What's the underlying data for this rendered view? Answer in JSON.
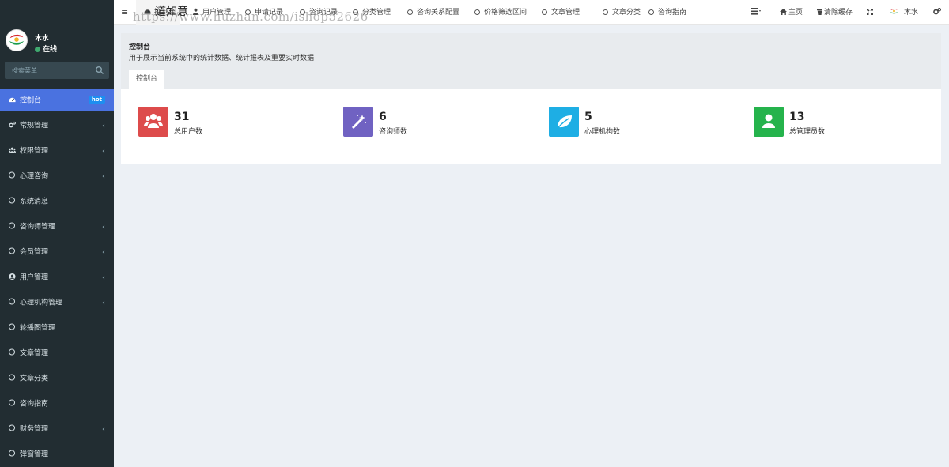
{
  "app": {
    "brand": "道如意",
    "watermark": "https://www.huzhan.com/ishop52626"
  },
  "user": {
    "name": "木水",
    "status": "在线"
  },
  "search": {
    "placeholder": "搜索菜单"
  },
  "sidebar": {
    "items": [
      {
        "label": "控制台",
        "icon": "dashboard-icon",
        "badge": "hot",
        "active": true
      },
      {
        "label": "常规管理",
        "icon": "cogs-icon",
        "arrow": true
      },
      {
        "label": "权限管理",
        "icon": "group-icon",
        "arrow": true
      },
      {
        "label": "心理咨询",
        "icon": "circle-icon",
        "arrow": true
      },
      {
        "label": "系统消息",
        "icon": "circle-icon"
      },
      {
        "label": "咨询师管理",
        "icon": "circle-icon",
        "arrow": true
      },
      {
        "label": "会员管理",
        "icon": "circle-icon",
        "arrow": true
      },
      {
        "label": "用户管理",
        "icon": "user-circle-icon",
        "arrow": true
      },
      {
        "label": "心理机构管理",
        "icon": "circle-icon",
        "arrow": true
      },
      {
        "label": "轮播图管理",
        "icon": "circle-icon"
      },
      {
        "label": "文章管理",
        "icon": "circle-icon"
      },
      {
        "label": "文章分类",
        "icon": "circle-icon"
      },
      {
        "label": "咨询指南",
        "icon": "circle-icon"
      },
      {
        "label": "财务管理",
        "icon": "circle-icon",
        "arrow": true
      },
      {
        "label": "弹窗管理",
        "icon": "circle-icon"
      }
    ],
    "arrow_glyph": "‹"
  },
  "topnav": {
    "menu_toggle": "≡",
    "tabs": [
      {
        "label": "控制台",
        "icon": "dashboard-icon"
      },
      {
        "label": "用户管理",
        "icon": "user-icon"
      },
      {
        "label": "申请记录",
        "icon": "circle-icon"
      },
      {
        "label": "咨询记录",
        "icon": "circle-icon"
      },
      {
        "label": "分类管理",
        "icon": "circle-icon"
      },
      {
        "label": "咨询关系配置",
        "icon": "circle-icon"
      },
      {
        "label": "价格筛选区间",
        "icon": "circle-icon"
      },
      {
        "label": "文章管理",
        "icon": "circle-icon"
      },
      {
        "label": "文章分类",
        "icon": "circle-icon"
      },
      {
        "label": "咨询指南",
        "icon": "circle-icon"
      }
    ],
    "right": {
      "home": "主页",
      "clear_cache": "清除缓存",
      "user": "木水"
    }
  },
  "content": {
    "title": "控制台",
    "description": "用于展示当前系统中的统计数据、统计报表及重要实时数据",
    "tab": "控制台"
  },
  "stats": [
    {
      "value": "31",
      "label": "总用户数",
      "color": "#dd4b4b",
      "icon": "users-icon"
    },
    {
      "value": "6",
      "label": "咨询师数",
      "color": "#7062c2",
      "icon": "magic-wand-icon"
    },
    {
      "value": "5",
      "label": "心理机构数",
      "color": "#1eaee4",
      "icon": "leaf-icon"
    },
    {
      "value": "13",
      "label": "总管理员数",
      "color": "#25b34c",
      "icon": "user-icon"
    }
  ]
}
